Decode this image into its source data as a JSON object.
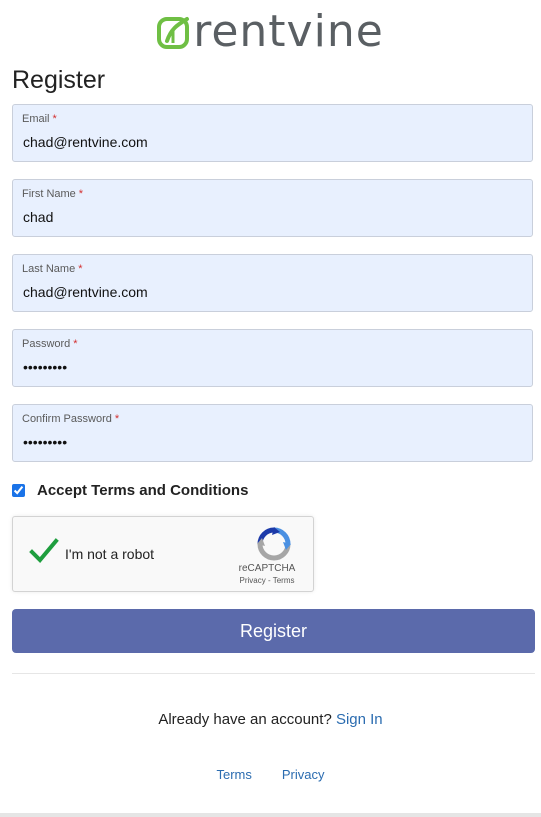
{
  "brand": {
    "logo_text": "rentvine",
    "logo_color": "#5a5f63",
    "leaf_color": "#6fbf44"
  },
  "page": {
    "title": "Register"
  },
  "form": {
    "required_marker": "*",
    "email": {
      "label": "Email",
      "value": "chad@rentvine.com"
    },
    "first_name": {
      "label": "First Name",
      "value": "chad"
    },
    "last_name": {
      "label": "Last Name",
      "value": "chad@rentvine.com"
    },
    "password": {
      "label": "Password",
      "value": "•••••••••"
    },
    "confirm_password": {
      "label": "Confirm Password",
      "value": "•••••••••"
    },
    "accept_terms": {
      "label": "Accept Terms and Conditions",
      "checked": true
    },
    "field_background": "#e8f0fe"
  },
  "recaptcha": {
    "label": "I'm not a robot",
    "brand": "reCAPTCHA",
    "privacy": "Privacy",
    "separator": "-",
    "terms": "Terms",
    "check_color": "#1e9e3e"
  },
  "actions": {
    "register_label": "Register",
    "register_color": "#5b6aab"
  },
  "signin": {
    "prompt": "Already have an account?",
    "link": "Sign In"
  },
  "footer": {
    "terms": "Terms",
    "privacy": "Privacy",
    "link_color": "#2b6cb0"
  }
}
